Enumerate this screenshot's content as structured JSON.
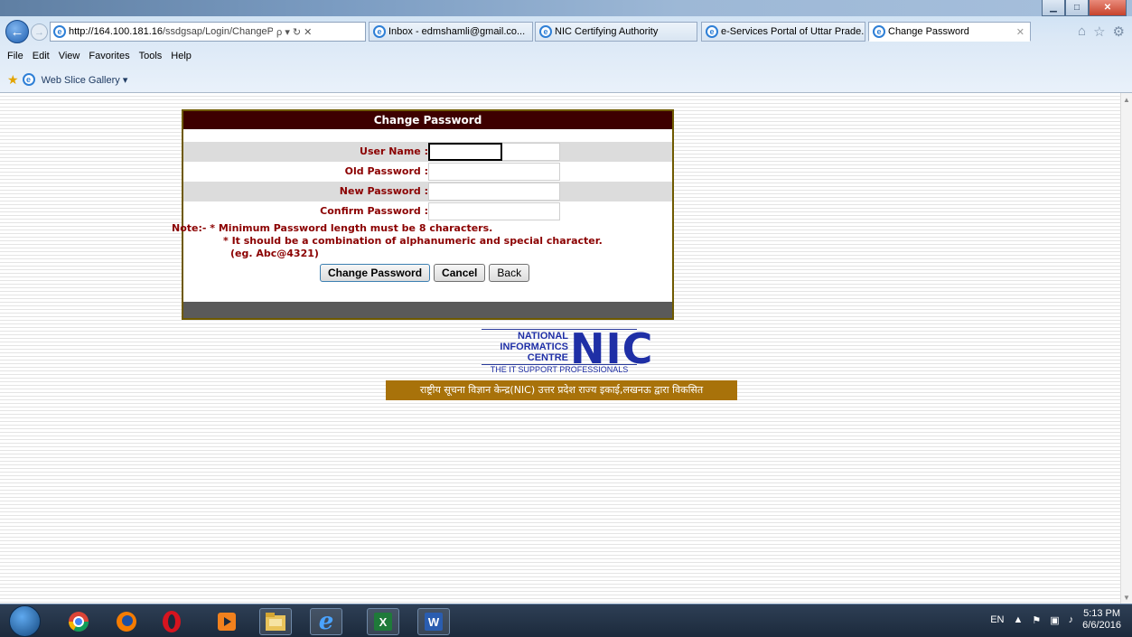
{
  "browser": {
    "url_host": "http://164.100.181.16",
    "url_path": "/ssdgsap/Login/ChangePassw",
    "addr_icons": "ρ ▾ ↻ ✕",
    "tabs": [
      {
        "label": "Inbox - edmshamli@gmail.co...",
        "active": false
      },
      {
        "label": "NIC Certifying Authority",
        "active": false
      },
      {
        "label": "e-Services Portal of Uttar Prade...",
        "active": false
      },
      {
        "label": "Change Password",
        "active": true
      }
    ],
    "menu": [
      "File",
      "Edit",
      "View",
      "Favorites",
      "Tools",
      "Help"
    ],
    "favorites_item": "Web Slice Gallery ▾"
  },
  "form": {
    "title": "Change Password",
    "fields": [
      {
        "label": "User Name :",
        "value": ""
      },
      {
        "label": "Old Password :",
        "value": ""
      },
      {
        "label": "New Password :",
        "value": ""
      },
      {
        "label": "Confirm Password :",
        "value": ""
      }
    ],
    "note_line1": "Note:- * Minimum Password length must be 8 characters.",
    "note_line2": "* It should be a combination of alphanumeric and special character.",
    "note_line3": "(eg. Abc@4321)",
    "buttons": {
      "change": "Change Password",
      "cancel": "Cancel",
      "back": "Back"
    }
  },
  "footer": {
    "nic_line1": "NATIONAL",
    "nic_line2": "INFORMATICS",
    "nic_line3": "CENTRE",
    "nic_big": "NIC",
    "nic_tagline": "THE IT SUPPORT PROFESSIONALS",
    "hindi_credit": "राष्ट्रीय सूचना विज्ञान केन्द्र(NIC) उत्तर प्रदेश राज्य इकाई,लखनऊ द्वारा विकसित"
  },
  "taskbar": {
    "lang": "EN",
    "time": "5:13 PM",
    "date": "6/6/2016"
  }
}
